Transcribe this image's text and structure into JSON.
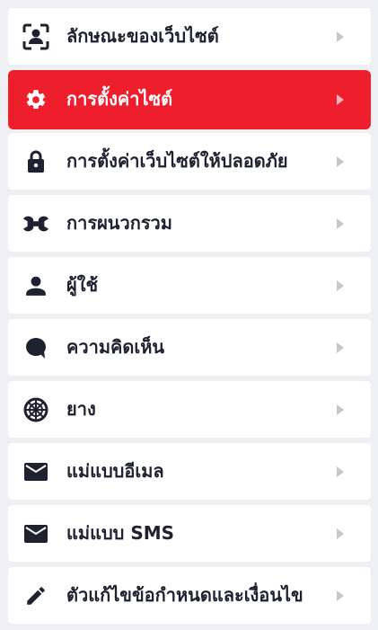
{
  "menu": {
    "items": [
      {
        "label": "ลักษณะของเว็บไซต์",
        "icon": "user-frame-icon",
        "active": false
      },
      {
        "label": "การตั้งค่าไซต์",
        "icon": "gear-icon",
        "active": true
      },
      {
        "label": "การตั้งค่าเว็บไซต์ให้ปลอดภัย",
        "icon": "lock-icon",
        "active": false
      },
      {
        "label": "การผนวกรวม",
        "icon": "wrench-icon",
        "active": false
      },
      {
        "label": "ผู้ใช้",
        "icon": "user-icon",
        "active": false
      },
      {
        "label": "ความคิดเห็น",
        "icon": "comment-icon",
        "active": false
      },
      {
        "label": "ยาง",
        "icon": "tire-icon",
        "active": false
      },
      {
        "label": "แม่แบบอีเมล",
        "icon": "envelope-icon",
        "active": false
      },
      {
        "label": "แม่แบบ SMS",
        "icon": "envelope-icon",
        "active": false
      },
      {
        "label": "ตัวแก้ไขข้อกำหนดและเงื่อนไข",
        "icon": "pencil-icon",
        "active": false
      }
    ],
    "colors": {
      "active_background": "#ee1e2d",
      "item_background": "#ffffff",
      "text": "#1e2130",
      "page_background": "#eef0f3"
    }
  }
}
